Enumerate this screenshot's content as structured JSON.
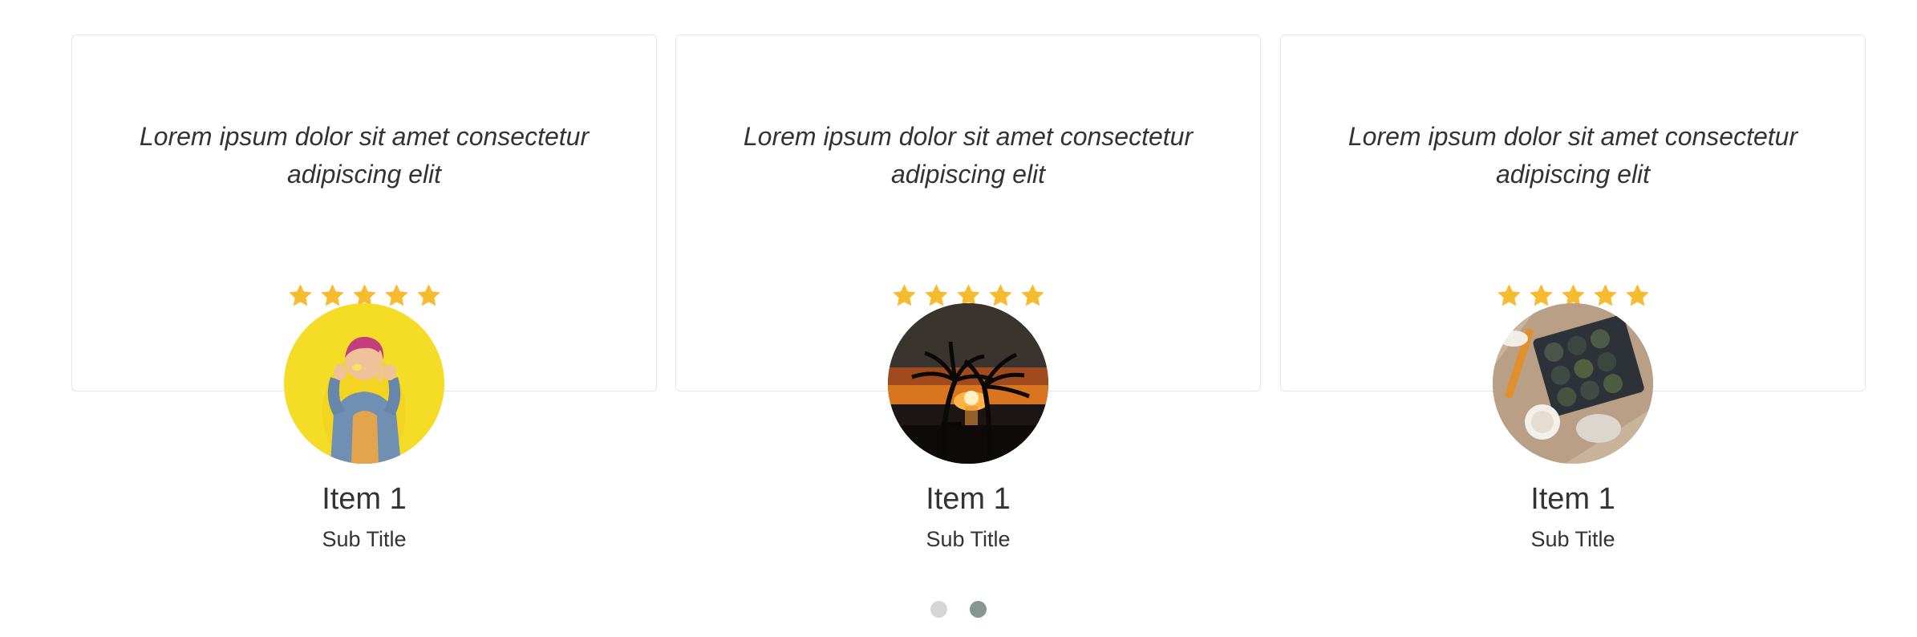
{
  "colors": {
    "star": "#f7bb2f",
    "card_border": "#e6e6e6",
    "text": "#333333",
    "dot_inactive": "#d6d6d6",
    "dot_active": "#869791"
  },
  "testimonials": [
    {
      "quote": "Lorem ipsum dolor sit amet consectetur adipiscing elit",
      "rating": 5,
      "avatar_subject": "woman in denim jacket on yellow background",
      "title": "Item 1",
      "subtitle": "Sub Title"
    },
    {
      "quote": "Lorem ipsum dolor sit amet consectetur adipiscing elit",
      "rating": 5,
      "avatar_subject": "palm trees at sunset",
      "title": "Item 1",
      "subtitle": "Sub Title"
    },
    {
      "quote": "Lorem ipsum dolor sit amet consectetur adipiscing elit",
      "rating": 5,
      "avatar_subject": "seedling tray on wooden table",
      "title": "Item 1",
      "subtitle": "Sub Title"
    }
  ],
  "pagination": {
    "total": 2,
    "active": 2
  }
}
